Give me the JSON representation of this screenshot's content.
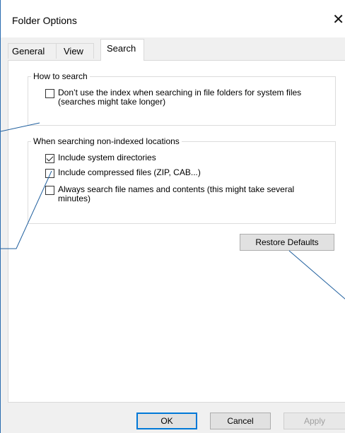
{
  "window": {
    "title": "Folder Options",
    "close_icon": "close-icon",
    "close_glyph": "✕"
  },
  "tabs": [
    {
      "label": "General",
      "active": false
    },
    {
      "label": "View",
      "active": false
    },
    {
      "label": "Search",
      "active": true
    }
  ],
  "how_to_search": {
    "legend": "How to search",
    "options": [
      {
        "label": "Don’t use the index when searching in file folders for system files (searches might take longer)",
        "checked": false
      }
    ]
  },
  "non_indexed": {
    "legend": "When searching non-indexed locations",
    "options": [
      {
        "label": "Include system directories",
        "checked": true
      },
      {
        "label": "Include compressed files (ZIP, CAB...)",
        "checked": false
      },
      {
        "label": "Always search file names and contents (this might take several minutes)",
        "checked": false
      }
    ]
  },
  "buttons": {
    "restore_defaults": "Restore Defaults",
    "ok": "OK",
    "cancel": "Cancel",
    "apply": "Apply"
  },
  "colors": {
    "accent": "#0078d7",
    "annotation_line": "#1f5f9e"
  }
}
